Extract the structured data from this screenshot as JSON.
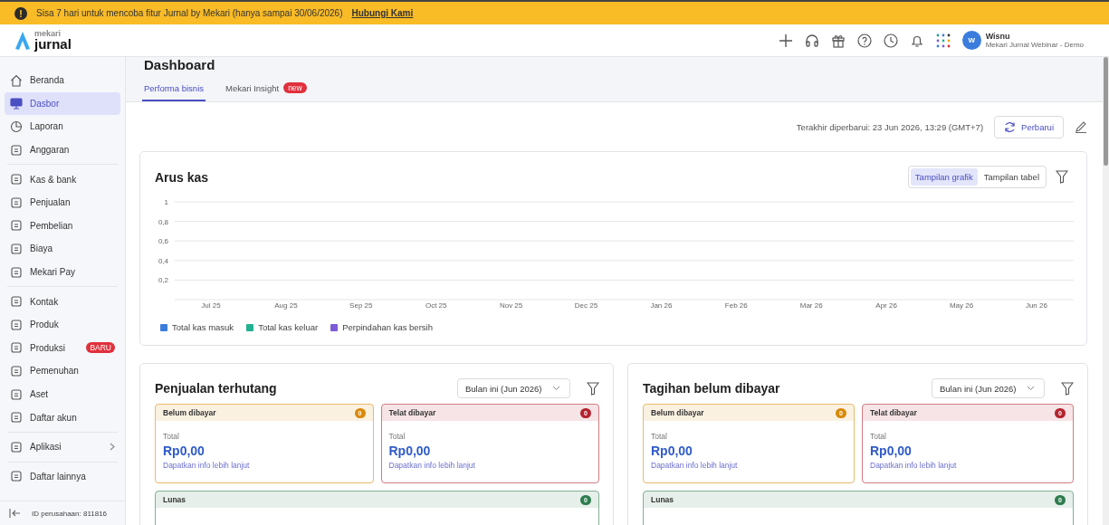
{
  "banner": {
    "message": "Sisa 7 hari untuk mencoba fitur Jurnal by Mekari (hanya sampai 30/06/2026)",
    "link": "Hubungi Kami"
  },
  "logo": {
    "brand": "mekari",
    "product": "jurnal"
  },
  "user": {
    "avatar": "W",
    "name": "Wisnu",
    "company": "Mekari Jurnal Webinar - Demo"
  },
  "sidebar": {
    "groups": [
      [
        {
          "label": "Beranda",
          "selected": false,
          "kind": "link"
        },
        {
          "label": "Dasbor",
          "selected": true,
          "kind": "link"
        },
        {
          "label": "Laporan",
          "selected": false,
          "kind": "link"
        },
        {
          "label": "Anggaran",
          "selected": false,
          "kind": "link"
        }
      ],
      [
        {
          "label": "Kas & bank",
          "selected": false,
          "kind": "link"
        },
        {
          "label": "Penjualan",
          "selected": false,
          "kind": "link"
        },
        {
          "label": "Pembelian",
          "selected": false,
          "kind": "link"
        },
        {
          "label": "Biaya",
          "selected": false,
          "kind": "link"
        },
        {
          "label": "Mekari Pay",
          "selected": false,
          "kind": "link"
        }
      ],
      [
        {
          "label": "Kontak",
          "selected": false,
          "kind": "link"
        },
        {
          "label": "Produk",
          "selected": false,
          "kind": "link"
        },
        {
          "label": "Produksi",
          "selected": false,
          "kind": "link",
          "badge": "BARU"
        },
        {
          "label": "Pemenuhan",
          "selected": false,
          "kind": "link"
        },
        {
          "label": "Aset",
          "selected": false,
          "kind": "link"
        },
        {
          "label": "Daftar akun",
          "selected": false,
          "kind": "link"
        }
      ],
      [
        {
          "label": "Aplikasi",
          "selected": false,
          "kind": "submenu"
        }
      ],
      [
        {
          "label": "Daftar lainnya",
          "selected": false,
          "kind": "link"
        }
      ]
    ],
    "company_id": "ID perusahaan: 811816"
  },
  "page": {
    "title": "Dashboard"
  },
  "tabs": [
    {
      "label": "Performa bisnis",
      "selected": true
    },
    {
      "label": "Mekari Insight",
      "selected": false,
      "badge": "new"
    }
  ],
  "last_updated": "Terakhir diperbarui: 23 Jun 2026, 13:29 (GMT+7)",
  "refresh_button": "Perbarui",
  "cash_flow": {
    "title": "Arus kas",
    "views": [
      {
        "label": "Tampilan grafik",
        "selected": true
      },
      {
        "label": "Tampilan tabel",
        "selected": false
      }
    ],
    "chart_data": {
      "type": "line",
      "ylim": [
        0,
        1
      ],
      "grid": true,
      "categories": [
        "Jul 25",
        "Aug 25",
        "Sep 25",
        "Oct 25",
        "Nov 25",
        "Dec 25",
        "Jan 26",
        "Feb 26",
        "Mar 26",
        "Apr 26",
        "May 26",
        "Jun 26"
      ],
      "yticks": [
        {
          "value": 0.2,
          "label": "0,2"
        },
        {
          "value": 0.4,
          "label": "0,4"
        },
        {
          "value": 0.6,
          "label": "0,6"
        },
        {
          "value": 0.8,
          "label": "0,8"
        },
        {
          "value": 1,
          "label": "1"
        }
      ],
      "series": [
        {
          "name": "Total kas masuk",
          "color": "#3b7ddd",
          "values": [
            null,
            null,
            null,
            null,
            null,
            null,
            null,
            null,
            null,
            null,
            null,
            null
          ]
        },
        {
          "name": "Total kas keluar",
          "color": "#23b08f",
          "values": [
            null,
            null,
            null,
            null,
            null,
            null,
            null,
            null,
            null,
            null,
            null,
            null
          ]
        },
        {
          "name": "Perpindahan kas bersih",
          "color": "#7b5cd6",
          "values": [
            null,
            null,
            null,
            null,
            null,
            null,
            null,
            null,
            null,
            null,
            null,
            null
          ]
        }
      ]
    }
  },
  "panels": [
    {
      "title": "Penjualan terhutang",
      "period": "Bulan ini (Jun 2026)",
      "statuses": [
        {
          "label": "Belum dibayar",
          "count": "0",
          "color": "#d98a0b",
          "total_label": "Total",
          "amount": "Rp0,00",
          "link": "Dapatkan info lebih lanjut"
        },
        {
          "label": "Telat dibayar",
          "count": "0",
          "color": "#b3242f",
          "total_label": "Total",
          "amount": "Rp0,00",
          "link": "Dapatkan info lebih lanjut"
        },
        {
          "label": "Lunas",
          "count": "0",
          "color": "#2e7d4f"
        }
      ]
    },
    {
      "title": "Tagihan belum dibayar",
      "period": "Bulan ini (Jun 2026)",
      "statuses": [
        {
          "label": "Belum dibayar",
          "count": "0",
          "color": "#d98a0b",
          "total_label": "Total",
          "amount": "Rp0,00",
          "link": "Dapatkan info lebih lanjut"
        },
        {
          "label": "Telat dibayar",
          "count": "0",
          "color": "#b3242f",
          "total_label": "Total",
          "amount": "Rp0,00",
          "link": "Dapatkan info lebih lanjut"
        },
        {
          "label": "Lunas",
          "count": "0",
          "color": "#2e7d4f"
        }
      ]
    }
  ]
}
